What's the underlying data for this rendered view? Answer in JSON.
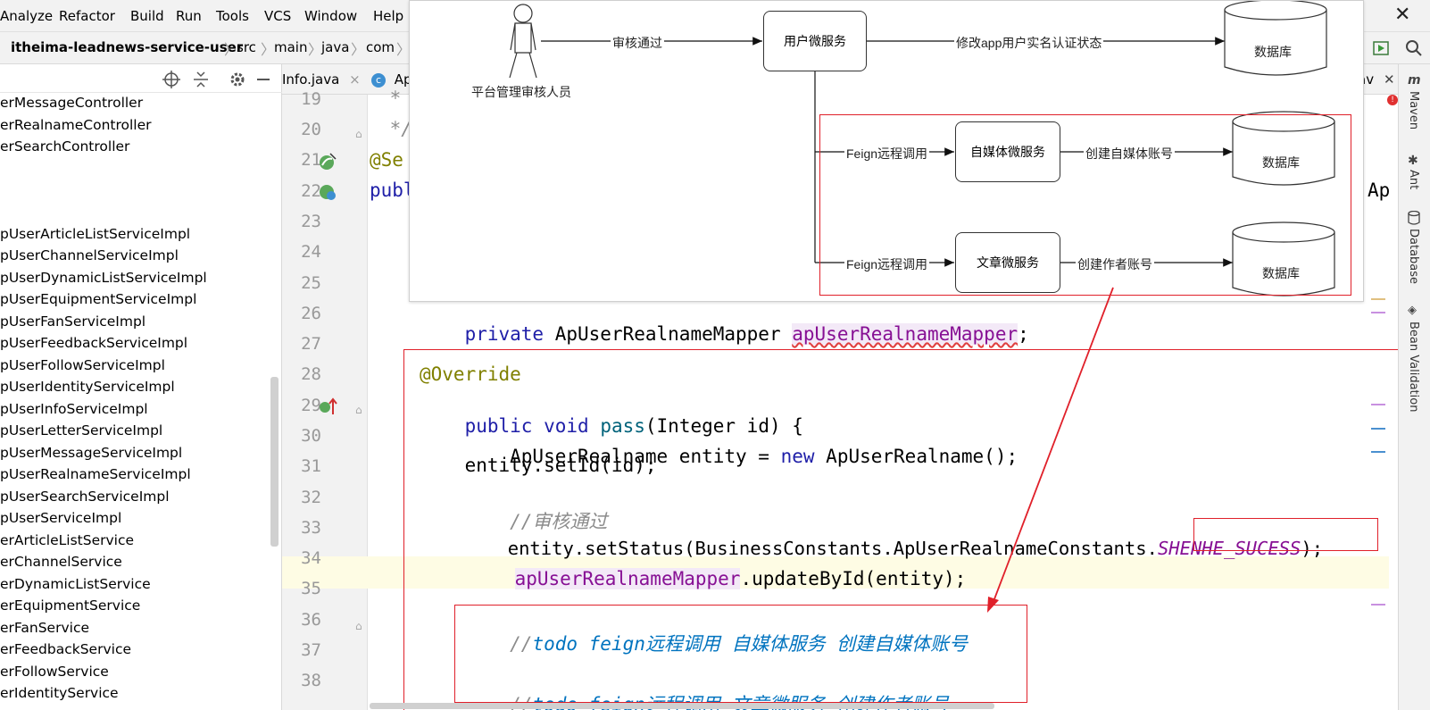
{
  "menu": {
    "items": [
      "Analyze",
      "Refactor",
      "Build",
      "Run",
      "Tools",
      "VCS",
      "Window",
      "Help"
    ],
    "close_glyph": "✕"
  },
  "breadcrumb": [
    "itheima-leadnews-service-user",
    "src",
    "main",
    "java",
    "com"
  ],
  "tabs": [
    {
      "label": "Info.java",
      "close": "×"
    },
    {
      "label": "Ap"
    }
  ],
  "tab_right_fragment": "av",
  "project_tree": [
    "erMessageController",
    "erRealnameController",
    "erSearchController",
    "pUserArticleListServiceImpl",
    "pUserChannelServiceImpl",
    "pUserDynamicListServiceImpl",
    "pUserEquipmentServiceImpl",
    "pUserFanServiceImpl",
    "pUserFeedbackServiceImpl",
    "pUserFollowServiceImpl",
    "pUserIdentityServiceImpl",
    "pUserInfoServiceImpl",
    "pUserLetterServiceImpl",
    "pUserMessageServiceImpl",
    "pUserRealnameServiceImpl",
    "pUserSearchServiceImpl",
    "pUserServiceImpl",
    "erArticleListService",
    "erChannelService",
    "erDynamicListService",
    "erEquipmentService",
    "erFanService",
    "erFeedbackService",
    "erFollowService",
    "erIdentityService"
  ],
  "editor": {
    "line_numbers": [
      "19",
      "20",
      "21",
      "22",
      "23",
      "24",
      "25",
      "26",
      "27",
      "28",
      "29",
      "30",
      "31",
      "32",
      "33",
      "34",
      "35",
      "36",
      "37",
      "38"
    ],
    "line19": " * ",
    "line20": " */",
    "line21": "@Se",
    "line22": "publ",
    "line22_right": "Ap",
    "line26": {
      "kw": "private ",
      "type": "ApUserRealnameMapper ",
      "field": "apUserRealnameMapper",
      "end": ";"
    },
    "line28": "@Override",
    "line29": {
      "kw1": "public ",
      "kw2": "void ",
      "meth": "pass",
      "rest": "(Integer id) {"
    },
    "line30": {
      "a": "    ApUserRealname entity = ",
      "kw": "new ",
      "b": "ApUserRealname();"
    },
    "line31": "    entity.setId(id);",
    "line32": {
      "slashes": "    //",
      "text": "审核通过"
    },
    "line33": {
      "a": "    entity.setStatus(BusinessConstants.ApUserRealnameConstants.",
      "const": "SHENHE_SUCESS",
      "b": ");"
    },
    "line34": {
      "field": "apUserRealnameMapper",
      "b": ".updateById(entity);"
    },
    "line36": {
      "slashes": "    //",
      "text": "todo feign远程调用 自媒体服务 创建自媒体账号"
    },
    "line38": {
      "slashes": "    //",
      "text": "todo feign远程调用 文章微服务 创建作者账号"
    }
  },
  "right_tools": [
    "Maven",
    "Ant",
    "Database",
    "Bean Validation"
  ],
  "diagram": {
    "actor_label": "平台管理审核人员",
    "edge_approve": "审核通过",
    "user_service": "用户微服务",
    "edge_update": "修改app用户实名认证状态",
    "db": "数据库",
    "edge_feign": "Feign远程调用",
    "media_service": "自媒体微服务",
    "edge_create_media": "创建自媒体账号",
    "article_service": "文章微服务",
    "edge_create_author": "创建作者账号"
  },
  "colors": {
    "annotation_red": "#e0202a",
    "keyword": "#1f1fa8",
    "field": "#871094",
    "todo": "#0073bf"
  }
}
